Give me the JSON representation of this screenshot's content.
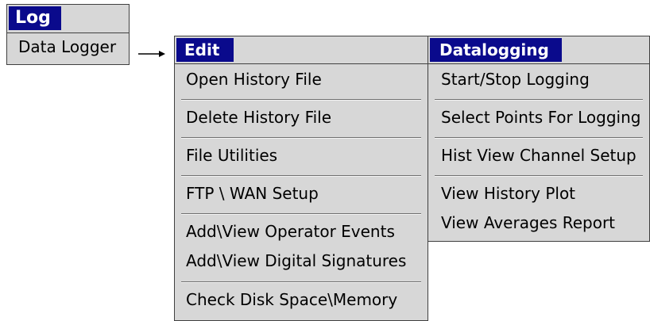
{
  "log_menu": {
    "title": "Log",
    "items": [
      "Data Logger"
    ]
  },
  "edit_menu": {
    "title": "Edit",
    "items": [
      "Open History File",
      "Delete History File",
      "File Utilities",
      "FTP \\ WAN Setup",
      "Add\\View Operator Events",
      "Add\\View Digital Signatures",
      "Check Disk Space\\Memory"
    ]
  },
  "datalogging_menu": {
    "title": "Datalogging",
    "items": [
      "Start/Stop Logging",
      "Select Points For Logging",
      "Hist View Channel Setup",
      "View History Plot",
      "View Averages Report"
    ]
  },
  "colors": {
    "header_background": "#0a0a8c",
    "header_text": "#ffffff",
    "panel_background": "#d7d7d7"
  },
  "icons": {
    "connector": "right-arrow-icon"
  }
}
